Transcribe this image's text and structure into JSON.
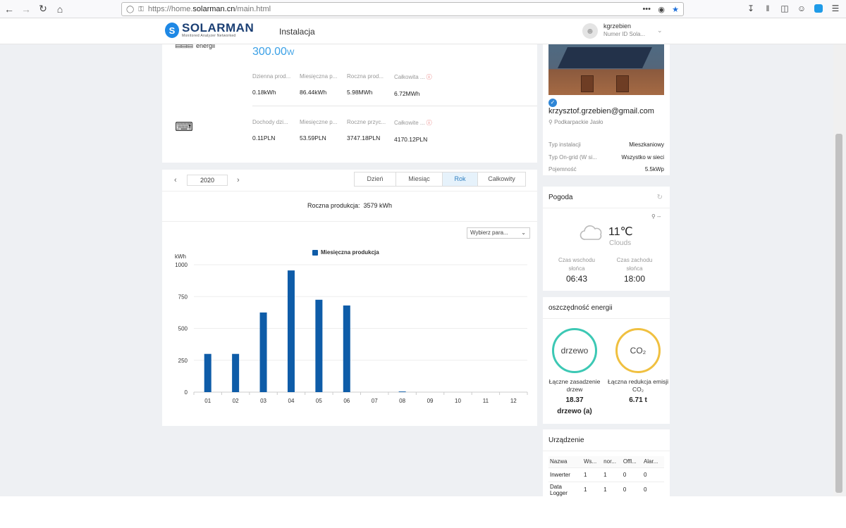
{
  "browser": {
    "url_prefix": "https://home.",
    "url_domain": "solarman.cn",
    "url_path": "/main.html",
    "menu_dots": "•••"
  },
  "header": {
    "logo_text": "SOLARMAN",
    "logo_subtext": "Monitored Analyzer Networked",
    "nav_item": "Instalacja",
    "username": "kgrzebien",
    "user_id_label": "Numer ID Sola..."
  },
  "summary": {
    "power_label": "energii",
    "power_value": "300.00",
    "power_unit": "W",
    "energy_metrics": [
      {
        "label": "Dzienna prod...",
        "value": "0.18kWh"
      },
      {
        "label": "Miesięczna p...",
        "value": "86.44kWh"
      },
      {
        "label": "Roczna prod...",
        "value": "5.98MWh"
      },
      {
        "label": "Całkowita ...",
        "value": "6.72MWh"
      }
    ],
    "income_metrics": [
      {
        "label": "Dochody dzi...",
        "value": "0.11PLN"
      },
      {
        "label": "Miesięczne p...",
        "value": "53.59PLN"
      },
      {
        "label": "Roczne przyc...",
        "value": "3747.18PLN"
      },
      {
        "label": "Całkowite ...",
        "value": "4170.12PLN"
      }
    ]
  },
  "period": {
    "year": "2020",
    "tabs": [
      "Dzień",
      "Miesiąc",
      "Rok",
      "Całkowity"
    ],
    "active_tab": "Rok",
    "annual_label": "Roczna produkcja:",
    "annual_value": "3579 kWh",
    "select_label": "Wybierz para..."
  },
  "chart_data": {
    "type": "bar",
    "ylabel": "kWh",
    "ylim": [
      0,
      1000
    ],
    "yticks": [
      0,
      250,
      500,
      750,
      1000
    ],
    "categories": [
      "01",
      "02",
      "03",
      "04",
      "05",
      "06",
      "07",
      "08",
      "09",
      "10",
      "11",
      "12"
    ],
    "series": [
      {
        "name": "Miesięczna produkcja",
        "values": [
          300,
          300,
          625,
          955,
          725,
          680,
          0,
          5,
          0,
          0,
          0,
          0
        ],
        "color": "#0e5ca8"
      }
    ],
    "legend_position": "top-center",
    "grid": true
  },
  "installation": {
    "email": "krzysztof.grzebien@gmail.com",
    "location": "Podkarpackie Jasło",
    "rows": [
      {
        "key": "Typ instalacji",
        "value": "Mieszkaniowy"
      },
      {
        "key": "Typ On-grid (W si...",
        "value": "Wszystko w sieci"
      },
      {
        "key": "Pojemność",
        "value": "5.5kWp"
      }
    ]
  },
  "weather": {
    "title": "Pogoda",
    "location": "--",
    "temperature": "11℃",
    "condition": "Clouds",
    "sunrise_label": "Czas wschodu słońca",
    "sunrise_time": "06:43",
    "sunset_label": "Czas zachodu słońca",
    "sunset_time": "18:00"
  },
  "savings": {
    "title": "oszczędność energii",
    "tree_circle": "drzewo",
    "co2_circle": "CO₂",
    "tree_label": "Łączne zasadzenie drzew",
    "tree_value": "18.37",
    "tree_unit": "drzewo (a)",
    "co2_label": "Łączna redukcja emisji CO₂",
    "co2_value": "6.71 t",
    "tree_color": "#3cc8b4",
    "co2_color": "#f0c040"
  },
  "devices": {
    "title": "Urządzenie",
    "headers": [
      "Nazwa",
      "Ws...",
      "nor...",
      "Offl...",
      "Alar..."
    ],
    "rows": [
      [
        "Inwerter",
        "1",
        "1",
        "0",
        "0"
      ],
      [
        "Data Logger",
        "1",
        "1",
        "0",
        "0"
      ]
    ]
  }
}
